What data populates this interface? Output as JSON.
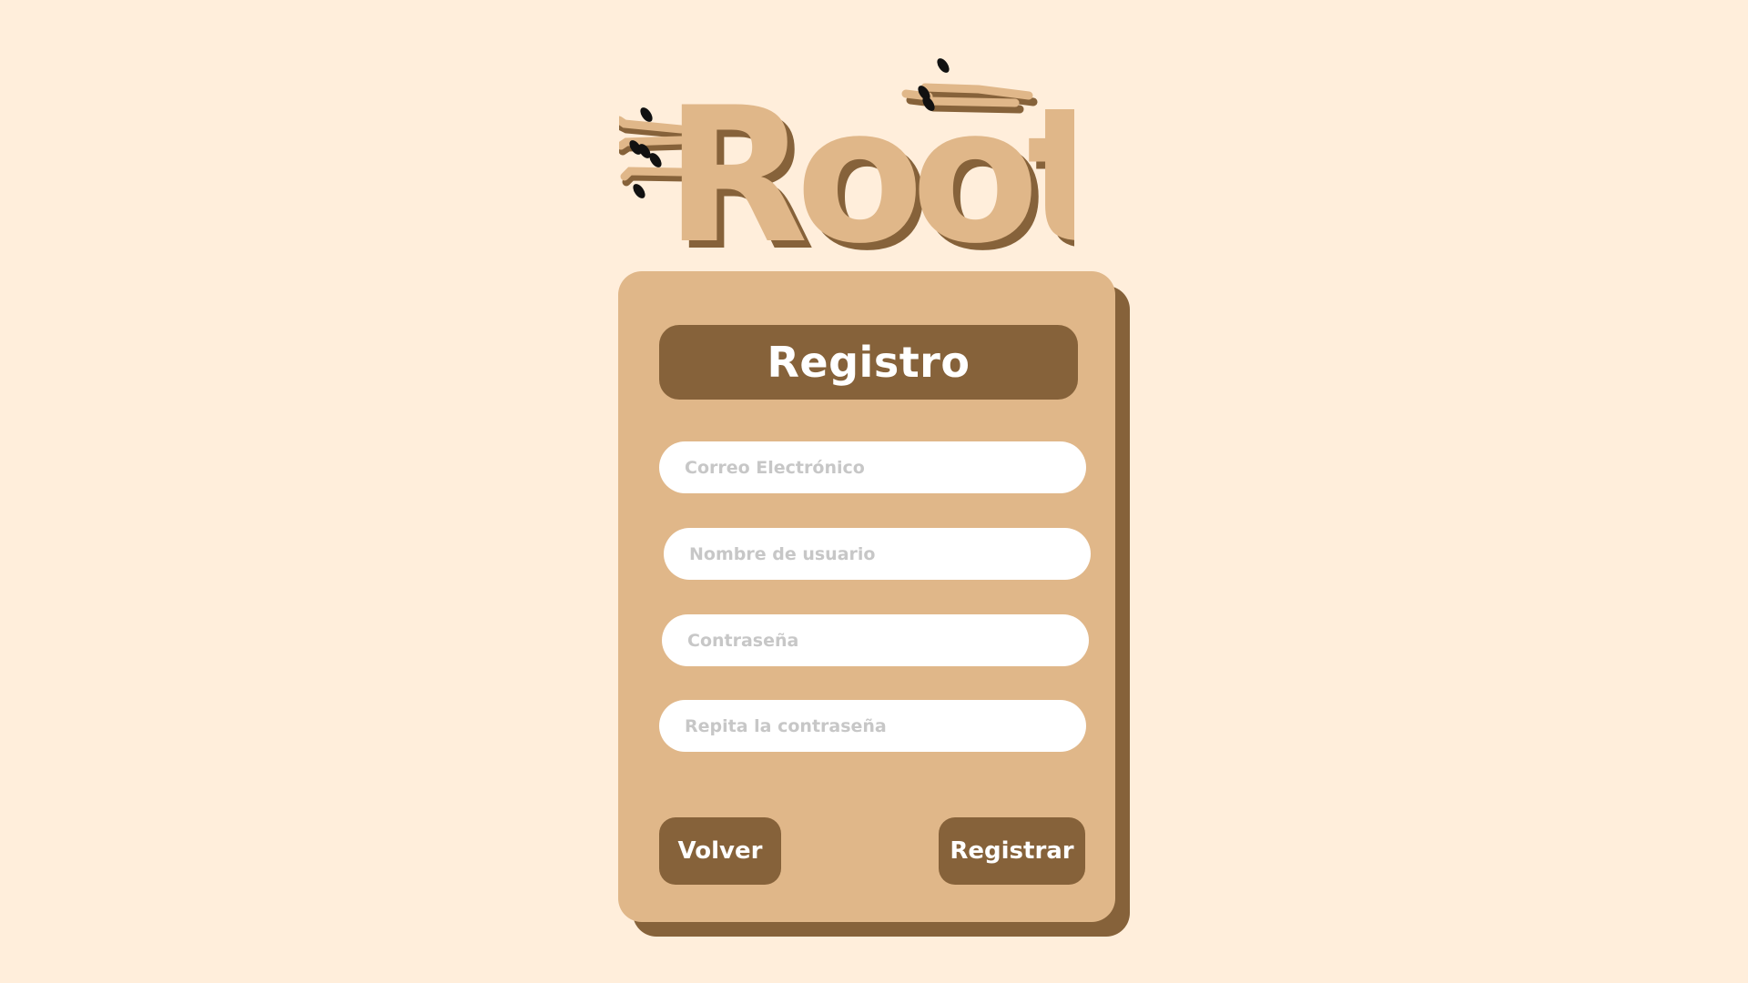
{
  "brand": {
    "logo_text": "Roots",
    "colors": {
      "background": "#FFEEDB",
      "logo_fill": "#E0B789",
      "logo_shadow": "#86623A",
      "leaf": "#111111"
    }
  },
  "form": {
    "title": "Registro",
    "fields": {
      "email_placeholder": "Correo Electrónico",
      "username_placeholder": "Nombre de usuario",
      "password_placeholder": "Contraseña",
      "password_repeat_placeholder": "Repita la contraseña"
    },
    "buttons": {
      "back_label": "Volver",
      "register_label": "Registrar"
    },
    "colors": {
      "card": "#E0B789",
      "card_shadow": "#86623A",
      "button": "#86623A",
      "input": "#FFFFFF",
      "placeholder": "#C7C7C7"
    }
  }
}
